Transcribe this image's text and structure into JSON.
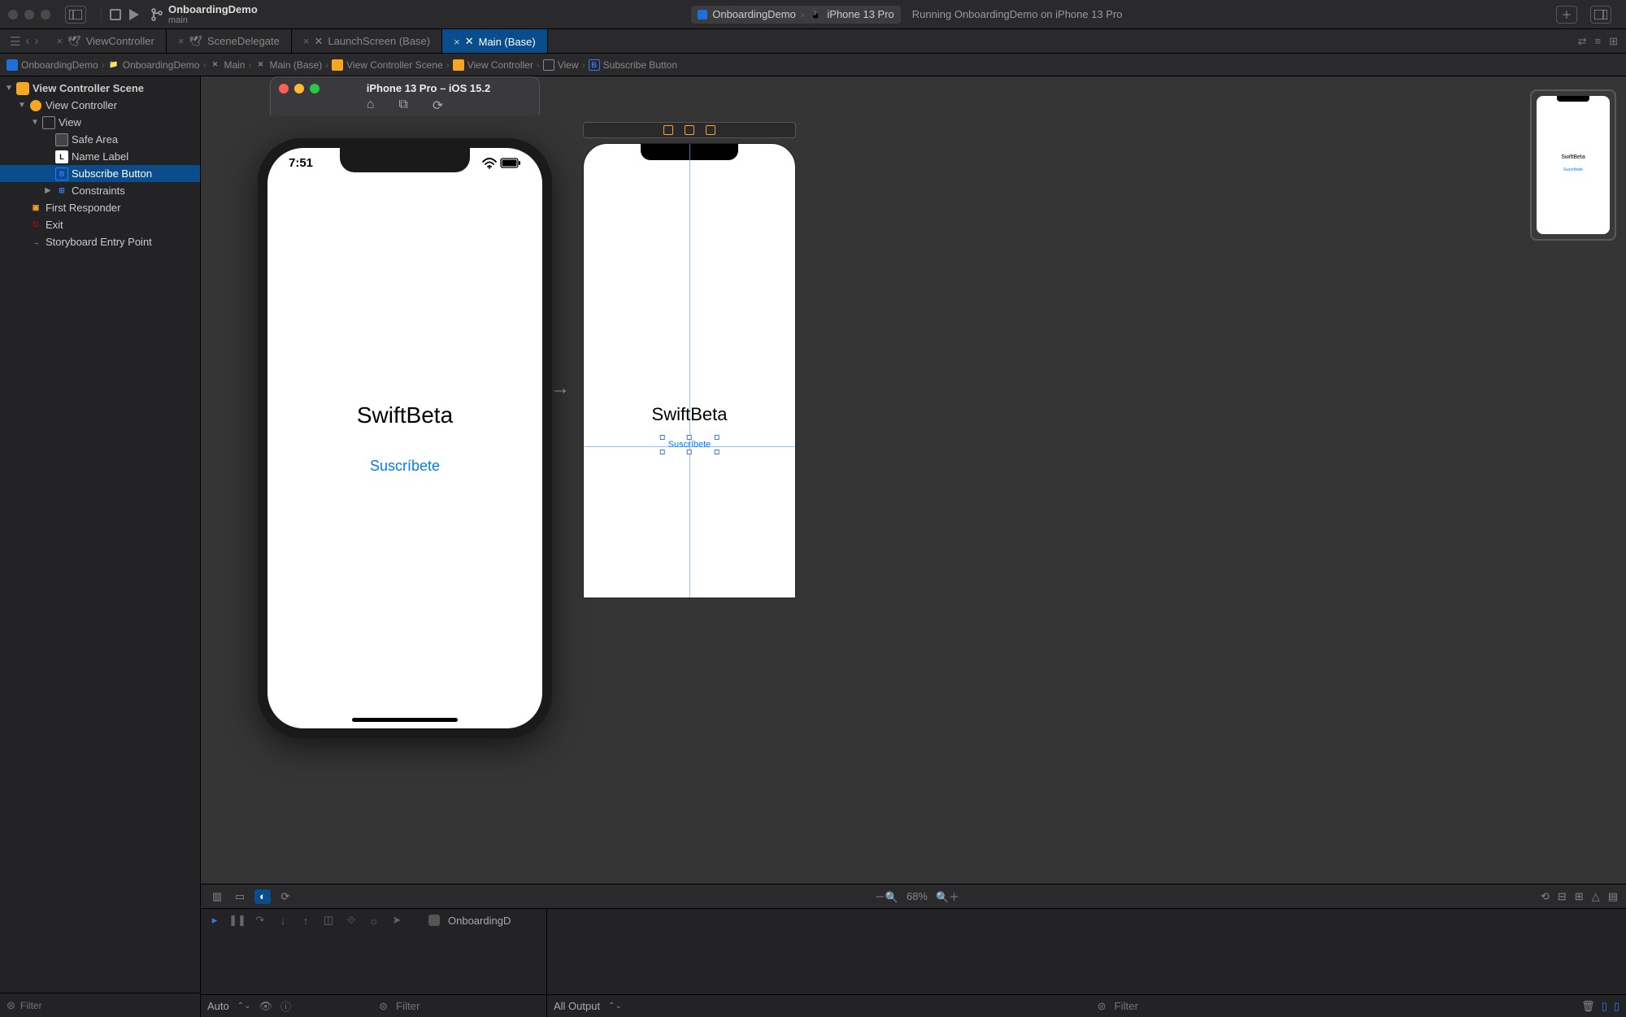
{
  "titlebar": {
    "project": "OnboardingDemo",
    "branch": "main",
    "scheme": "OnboardingDemo",
    "device": "iPhone 13 Pro",
    "status": "Running OnboardingDemo on iPhone 13 Pro"
  },
  "tabs": {
    "items": [
      {
        "label": "ViewController",
        "active": false
      },
      {
        "label": "SceneDelegate",
        "active": false
      },
      {
        "label": "LaunchScreen (Base)",
        "active": false
      },
      {
        "label": "Main (Base)",
        "active": true
      }
    ]
  },
  "breadcrumb": [
    "OnboardingDemo",
    "OnboardingDemo",
    "Main",
    "Main (Base)",
    "View Controller Scene",
    "View Controller",
    "View",
    "Subscribe Button"
  ],
  "outline": {
    "filter_placeholder": "Filter",
    "nodes": {
      "scene": "View Controller Scene",
      "vc": "View Controller",
      "view": "View",
      "safe": "Safe Area",
      "label": "Name Label",
      "button": "Subscribe Button",
      "constraints": "Constraints",
      "firstResponder": "First Responder",
      "exit": "Exit",
      "entry": "Storyboard Entry Point"
    }
  },
  "simulator": {
    "title": "iPhone 13 Pro – iOS 15.2",
    "time": "7:51",
    "label_text": "SwiftBeta",
    "button_text": "Suscríbete"
  },
  "ib_canvas": {
    "label_text": "SwiftBeta",
    "button_text": "Suscríbete",
    "zoom": "68%"
  },
  "minimap": {
    "label": "SwiftBeta",
    "button": "Suscríbete"
  },
  "debug": {
    "process": "OnboardingD",
    "auto_label": "Auto",
    "filter_placeholder": "Filter",
    "output_label": "All Output",
    "right_filter_placeholder": "Filter"
  }
}
